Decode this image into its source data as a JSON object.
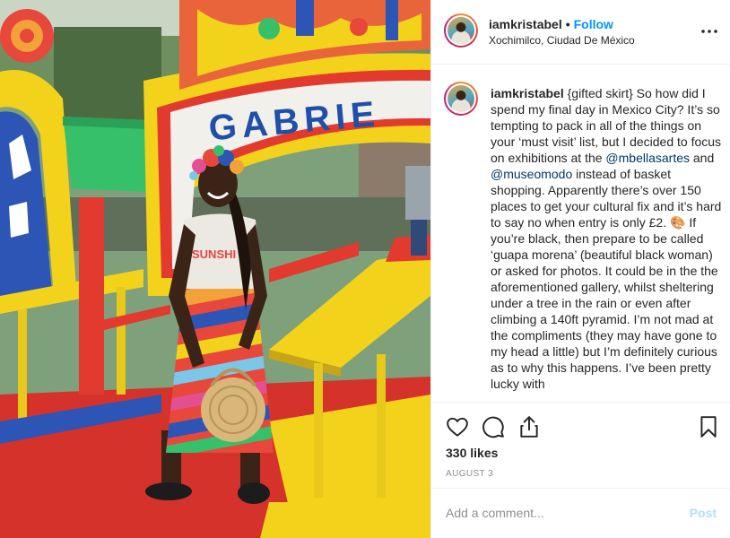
{
  "post": {
    "username": "iamkristabel",
    "follow_label": "Follow",
    "separator": "•",
    "location": "Xochimilco, Ciudad De México"
  },
  "photo": {
    "boat_sign_text": "GABRIE",
    "shirt_text": "SUNSHI",
    "sign_color": "#1f4fa8",
    "sign_background": "#f1f0ea"
  },
  "caption": {
    "username": "iamkristabel",
    "part1": " {gifted skirt} So how did I spend my final day in Mexico City? It’s so tempting to pack in all of the things on your ‘must visit’ list, but I decided to focus on exhibitions at the ",
    "mention1": "@mbellasartes",
    "part2": " and ",
    "mention2": "@museomodo",
    "part3": " instead of basket shopping. Apparently there’s over 150 places to get your cultural fix and it’s hard to say no when entry is only £2. 🎨 If you’re black, then prepare to be called ‘guapa morena’ (beautiful black woman) or asked for photos. It could be in the the aforementioned gallery, whilst sheltering under a tree in the rain or even after climbing a 140ft pyramid. I’m not mad at the compliments (they may have gone to my head a little) but I’m definitely curious as to why this happens. I’ve been pretty lucky with"
  },
  "actions": {
    "like_icon": "heart-icon",
    "comment_icon": "comment-bubble-icon",
    "share_icon": "share-upload-icon",
    "save_icon": "bookmark-icon"
  },
  "likes": "330 likes",
  "date": "AUGUST 3",
  "comment": {
    "placeholder": "Add a comment...",
    "post_label": "Post"
  },
  "colors": {
    "follow": "#0095f6",
    "mention": "#00376b",
    "post_disabled": "#b2dffc",
    "muted_text": "#8e8e8e"
  }
}
